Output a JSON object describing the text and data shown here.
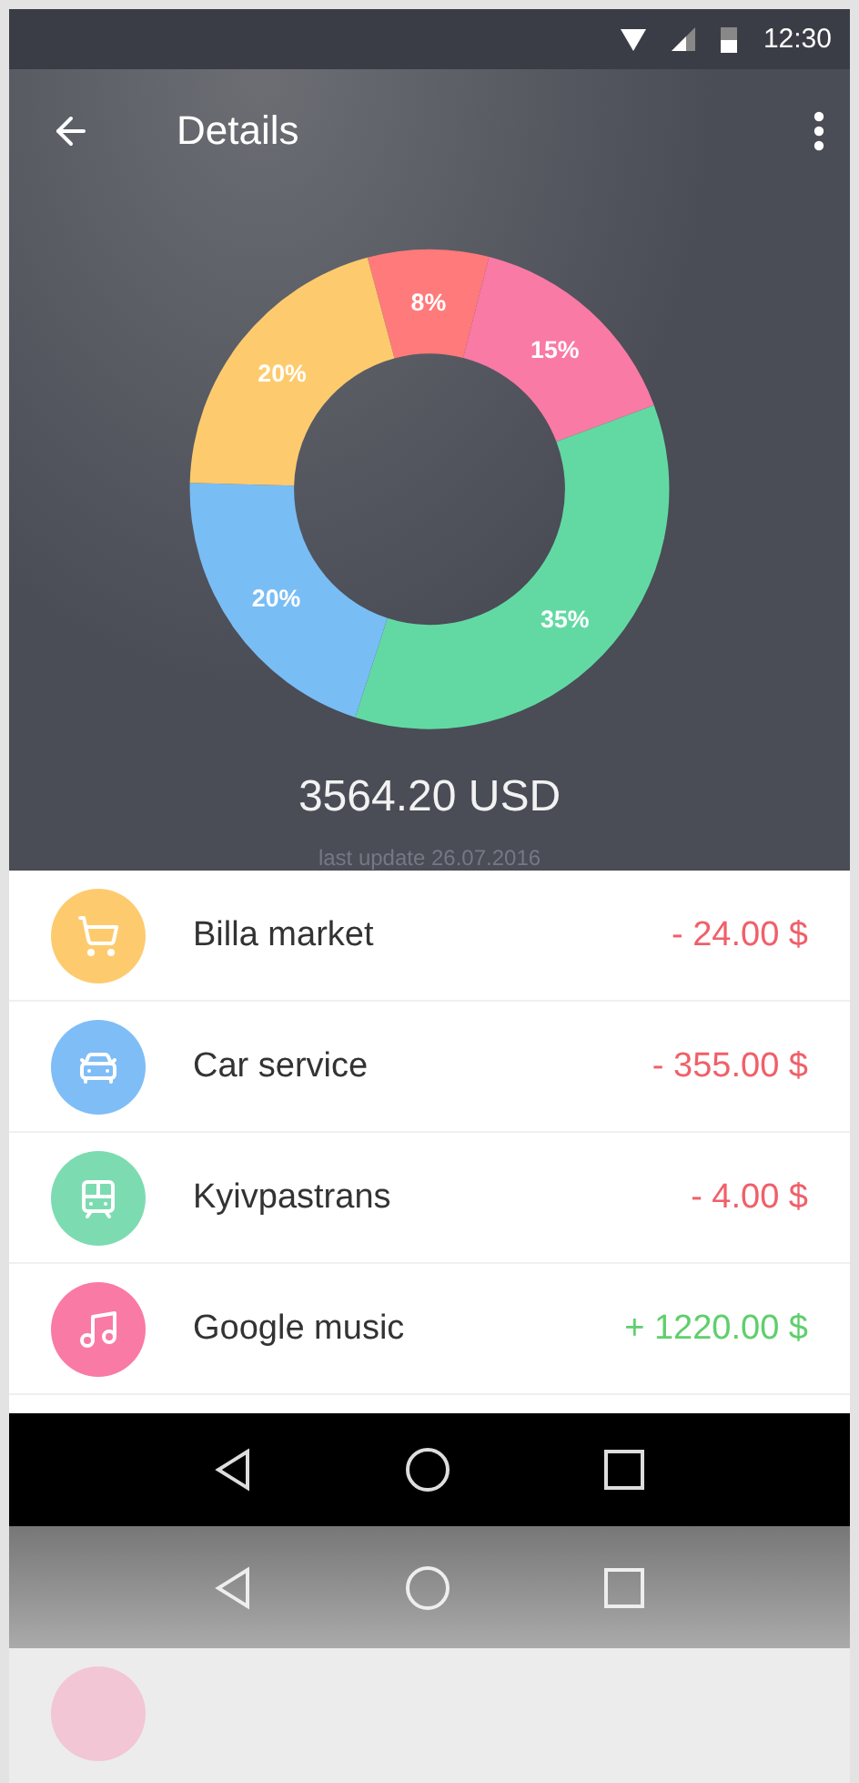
{
  "status_bar": {
    "time": "12:30"
  },
  "toolbar": {
    "title": "Details"
  },
  "summary": {
    "chart_data": {
      "type": "donut",
      "values": [
        8,
        15,
        35,
        20,
        20
      ],
      "value_labels": [
        "8%",
        "15%",
        "35%",
        "20%",
        "20%"
      ]
    },
    "total": "3564.20 USD",
    "updated": "last update 26.07.2016"
  },
  "transactions": [
    {
      "name": "Billa market",
      "amount": "- 24.00 $",
      "income": false,
      "kind": "cart",
      "color": "#fdcb6e"
    },
    {
      "name": "Car service",
      "amount": "- 355.00 $",
      "income": false,
      "kind": "car",
      "color": "#7fbdf6"
    },
    {
      "name": "Kyivpastrans",
      "amount": "- 4.00 $",
      "income": false,
      "kind": "tram",
      "color": "#7ddbb2"
    },
    {
      "name": "Google music",
      "amount": "+ 1220.00 $",
      "income": true,
      "kind": "music",
      "color": "#f97aa5"
    }
  ]
}
